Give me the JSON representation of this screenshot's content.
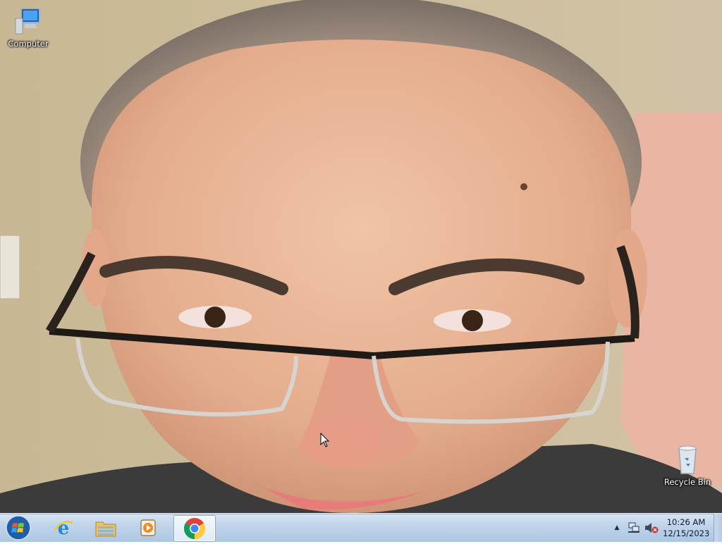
{
  "desktop": {
    "icons": [
      {
        "label": "Computer",
        "icon": "computer-icon"
      },
      {
        "label": "Recycle Bin",
        "icon": "recycle-bin-icon"
      }
    ]
  },
  "taskbar": {
    "start_icon": "windows-start-orb-icon",
    "pinned": [
      {
        "icon": "internet-explorer-icon",
        "active": false
      },
      {
        "icon": "file-explorer-icon",
        "active": false
      },
      {
        "icon": "windows-media-player-icon",
        "active": false
      },
      {
        "icon": "google-chrome-icon",
        "active": true
      }
    ],
    "tray": {
      "overflow_icon": "show-hidden-icons-arrow",
      "network_icon": "network-icon",
      "volume_icon": "volume-muted-icon",
      "time": "10:26 AM",
      "date": "12/15/2023"
    }
  },
  "colors": {
    "taskbar": "#c0d4ea",
    "wall": "#c9b999",
    "skin": "#e8b59a",
    "shirt": "#3a3a3a"
  }
}
